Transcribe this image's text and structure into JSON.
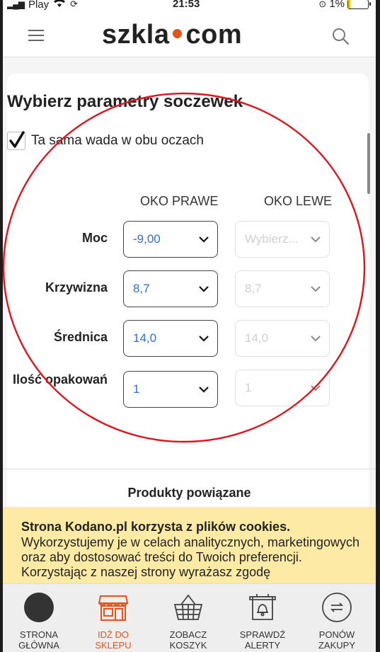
{
  "statusbar": {
    "carrier": "Play",
    "time": "21:53",
    "battery": "1%"
  },
  "header": {
    "logo_left": "szkla",
    "logo_right": "com"
  },
  "page": {
    "title": "Wybierz parametry soczewek",
    "same_defect_label": "Ta sama wada w obu oczach",
    "same_defect_checked": true,
    "columns": {
      "right": "OKO PRAWE",
      "left": "OKO LEWE"
    },
    "rows": [
      {
        "label": "Moc",
        "right": "-9,00",
        "left": "Wybierz..."
      },
      {
        "label": "Krzywizna",
        "right": "8,7",
        "left": "8,7"
      },
      {
        "label": "Średnica",
        "right": "14,0",
        "left": "14,0"
      },
      {
        "label": "Ilość opakowań",
        "right": "1",
        "left": "1"
      }
    ],
    "related_products": "Produkty powiązane"
  },
  "cookie": {
    "title": "Strona Kodano.pl korzysta z plików cookies.",
    "text": "Wykorzystujemy je w celach analitycznych, marketingowych oraz aby dostosować treści do Twoich preferencji. Korzystając z naszej strony wyrażasz zgodę"
  },
  "bottom_nav": [
    {
      "label": "STRONA GŁÓWNA",
      "icon": "home-circle-icon"
    },
    {
      "label": "IDŹ DO SKLEPU",
      "icon": "shop-icon",
      "active": true
    },
    {
      "label": "ZOBACZ KOSZYK",
      "icon": "basket-icon"
    },
    {
      "label": "SPRAWDŹ ALERTY",
      "icon": "bell-icon"
    },
    {
      "label": "PONÓW ZAKUPY",
      "icon": "repeat-icon"
    }
  ],
  "colors": {
    "accent": "#e2541c",
    "link_blue": "#2d6fd6",
    "cookie_bg": "#fdeba5",
    "annotation": "#e0141c"
  }
}
